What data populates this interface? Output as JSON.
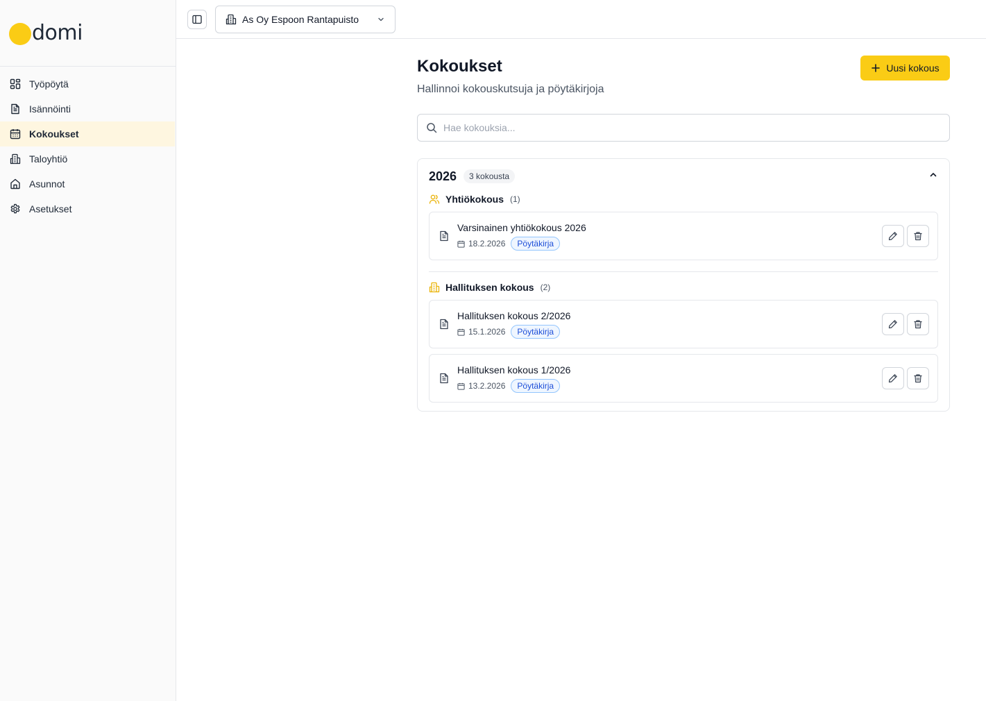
{
  "brand": {
    "name": "domi",
    "accent": "#facc15"
  },
  "sidebar": {
    "items": [
      {
        "label": "Työpöytä",
        "icon": "dashboard-icon",
        "active": false
      },
      {
        "label": "Isännöinti",
        "icon": "document-icon",
        "active": false
      },
      {
        "label": "Kokoukset",
        "icon": "calendar-icon",
        "active": true
      },
      {
        "label": "Taloyhtiö",
        "icon": "building-icon",
        "active": false
      },
      {
        "label": "Asunnot",
        "icon": "home-icon",
        "active": false
      },
      {
        "label": "Asetukset",
        "icon": "gear-icon",
        "active": false
      }
    ]
  },
  "topbar": {
    "company": "As Oy Espoon Rantapuisto"
  },
  "page": {
    "title": "Kokoukset",
    "subtitle": "Hallinnoi kokouskutsuja ja pöytäkirjoja",
    "new_button": "Uusi kokous",
    "search_placeholder": "Hae kokouksia..."
  },
  "year": {
    "title": "2026",
    "badge": "3 kokousta",
    "groups": [
      {
        "title": "Yhtiökokous",
        "count": "(1)",
        "icon": "users-icon",
        "meetings": [
          {
            "title": "Varsinainen yhtiökokous 2026",
            "date": "18.2.2026",
            "tag": "Pöytäkirja"
          }
        ]
      },
      {
        "title": "Hallituksen kokous",
        "count": "(2)",
        "icon": "building-icon",
        "meetings": [
          {
            "title": "Hallituksen kokous 2/2026",
            "date": "15.1.2026",
            "tag": "Pöytäkirja"
          },
          {
            "title": "Hallituksen kokous 1/2026",
            "date": "13.2.2026",
            "tag": "Pöytäkirja"
          }
        ]
      }
    ]
  }
}
